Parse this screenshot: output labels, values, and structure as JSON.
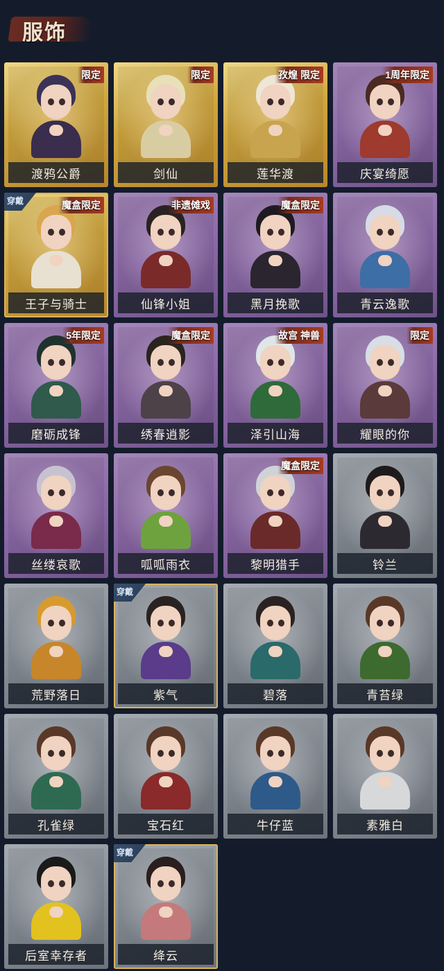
{
  "header": {
    "title": "服饰"
  },
  "wear_label": "穿戴",
  "cards": [
    {
      "name": "渡鸦公爵",
      "rarity": "gold",
      "tag": "限定",
      "worn": false,
      "hair": "#3b3257",
      "outfit": "#3a2d4e"
    },
    {
      "name": "剑仙",
      "rarity": "gold",
      "tag": "限定",
      "worn": false,
      "hair": "#e7e0b8",
      "outfit": "#d8cda2"
    },
    {
      "name": "莲华渡",
      "rarity": "gold",
      "tag": "孜煌 限定",
      "worn": false,
      "hair": "#eee6d6",
      "outfit": "#c9a44e"
    },
    {
      "name": "庆宴绮愿",
      "rarity": "purple",
      "tag": "1周年限定",
      "worn": false,
      "hair": "#4a2a22",
      "outfit": "#9e3a2e"
    },
    {
      "name": "王子与骑士",
      "rarity": "gold",
      "tag": "魔盒限定",
      "worn": true,
      "hair": "#d9a650",
      "outfit": "#e8e1d2"
    },
    {
      "name": "仙锋小姐",
      "rarity": "purple",
      "tag": "非遗傩戏",
      "worn": false,
      "hair": "#2a2222",
      "outfit": "#7b2a2a"
    },
    {
      "name": "黑月挽歌",
      "rarity": "purple",
      "tag": "魔盒限定",
      "worn": false,
      "hair": "#1f1a22",
      "outfit": "#2b2530"
    },
    {
      "name": "青云逸歌",
      "rarity": "purple",
      "tag": "",
      "worn": false,
      "hair": "#d7dbe6",
      "outfit": "#3d6ea6"
    },
    {
      "name": "磨砺成锋",
      "rarity": "purple",
      "tag": "5年限定",
      "worn": false,
      "hair": "#20322e",
      "outfit": "#2f5a4c"
    },
    {
      "name": "绣春逍影",
      "rarity": "purple",
      "tag": "魔盒限定",
      "worn": false,
      "hair": "#2a2420",
      "outfit": "#4c4248"
    },
    {
      "name": "泽引山海",
      "rarity": "purple",
      "tag": "故宫 神兽",
      "worn": false,
      "hair": "#dfe6e9",
      "outfit": "#2f6a3a"
    },
    {
      "name": "耀眼的你",
      "rarity": "purple",
      "tag": "限定",
      "worn": false,
      "hair": "#d8dde6",
      "outfit": "#5a3a3a"
    },
    {
      "name": "丝缕哀歌",
      "rarity": "purple",
      "tag": "",
      "worn": false,
      "hair": "#c7c2d0",
      "outfit": "#7a2a4a"
    },
    {
      "name": "呱呱雨衣",
      "rarity": "purple",
      "tag": "",
      "worn": false,
      "hair": "#6a4630",
      "outfit": "#6ea23e"
    },
    {
      "name": "黎明猎手",
      "rarity": "purple",
      "tag": "魔盒限定",
      "worn": false,
      "hair": "#cfd3d8",
      "outfit": "#6a2a2a"
    },
    {
      "name": "铃兰",
      "rarity": "gray",
      "tag": "",
      "worn": false,
      "hair": "#1e1b1c",
      "outfit": "#2c2a30"
    },
    {
      "name": "荒野落日",
      "rarity": "gray",
      "tag": "",
      "worn": false,
      "hair": "#d79a2e",
      "outfit": "#c7862a"
    },
    {
      "name": "紫气",
      "rarity": "gray",
      "tag": "",
      "worn": true,
      "hair": "#2a2222",
      "outfit": "#5a3c8a"
    },
    {
      "name": "碧落",
      "rarity": "gray",
      "tag": "",
      "worn": false,
      "hair": "#2a2222",
      "outfit": "#2a6a6a"
    },
    {
      "name": "青苔绿",
      "rarity": "gray",
      "tag": "",
      "worn": false,
      "hair": "#5a3828",
      "outfit": "#3d6a2e"
    },
    {
      "name": "孔雀绿",
      "rarity": "gray",
      "tag": "",
      "worn": false,
      "hair": "#5a3828",
      "outfit": "#2e6a52"
    },
    {
      "name": "宝石红",
      "rarity": "gray",
      "tag": "",
      "worn": false,
      "hair": "#5a3828",
      "outfit": "#8a2a2a"
    },
    {
      "name": "牛仔蓝",
      "rarity": "gray",
      "tag": "",
      "worn": false,
      "hair": "#5a3828",
      "outfit": "#2e5a8a"
    },
    {
      "name": "素雅白",
      "rarity": "gray",
      "tag": "",
      "worn": false,
      "hair": "#5a3828",
      "outfit": "#d6d8da"
    },
    {
      "name": "后室幸存者",
      "rarity": "gray",
      "tag": "",
      "worn": false,
      "hair": "#1a1a1a",
      "outfit": "#e2c21e"
    },
    {
      "name": "绛云",
      "rarity": "gray",
      "tag": "",
      "worn": true,
      "hair": "#2a1e1e",
      "outfit": "#c47a7a"
    }
  ]
}
